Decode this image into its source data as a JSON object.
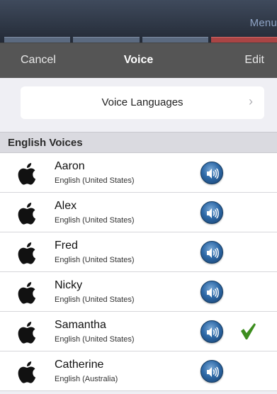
{
  "app_bar": {
    "menu_label": "Menu"
  },
  "nav": {
    "cancel_label": "Cancel",
    "title": "Voice",
    "edit_label": "Edit"
  },
  "languages_button": {
    "label": "Voice Languages",
    "chevron": "›"
  },
  "section": {
    "title": "English Voices"
  },
  "voices": [
    {
      "name": "Aaron",
      "language": "English (United States)",
      "selected": false
    },
    {
      "name": "Alex",
      "language": "English (United States)",
      "selected": false
    },
    {
      "name": "Fred",
      "language": "English (United States)",
      "selected": false
    },
    {
      "name": "Nicky",
      "language": "English (United States)",
      "selected": false
    },
    {
      "name": "Samantha",
      "language": "English (United States)",
      "selected": true
    },
    {
      "name": "Catherine",
      "language": "English (Australia)",
      "selected": false
    }
  ],
  "icons": {
    "vendor": "apple-logo-icon",
    "preview": "speaker-icon",
    "selected": "checkmark-icon"
  },
  "colors": {
    "nav_bar": "#555555",
    "check": "#3c8d1e",
    "speaker": "#2f6aa8"
  }
}
